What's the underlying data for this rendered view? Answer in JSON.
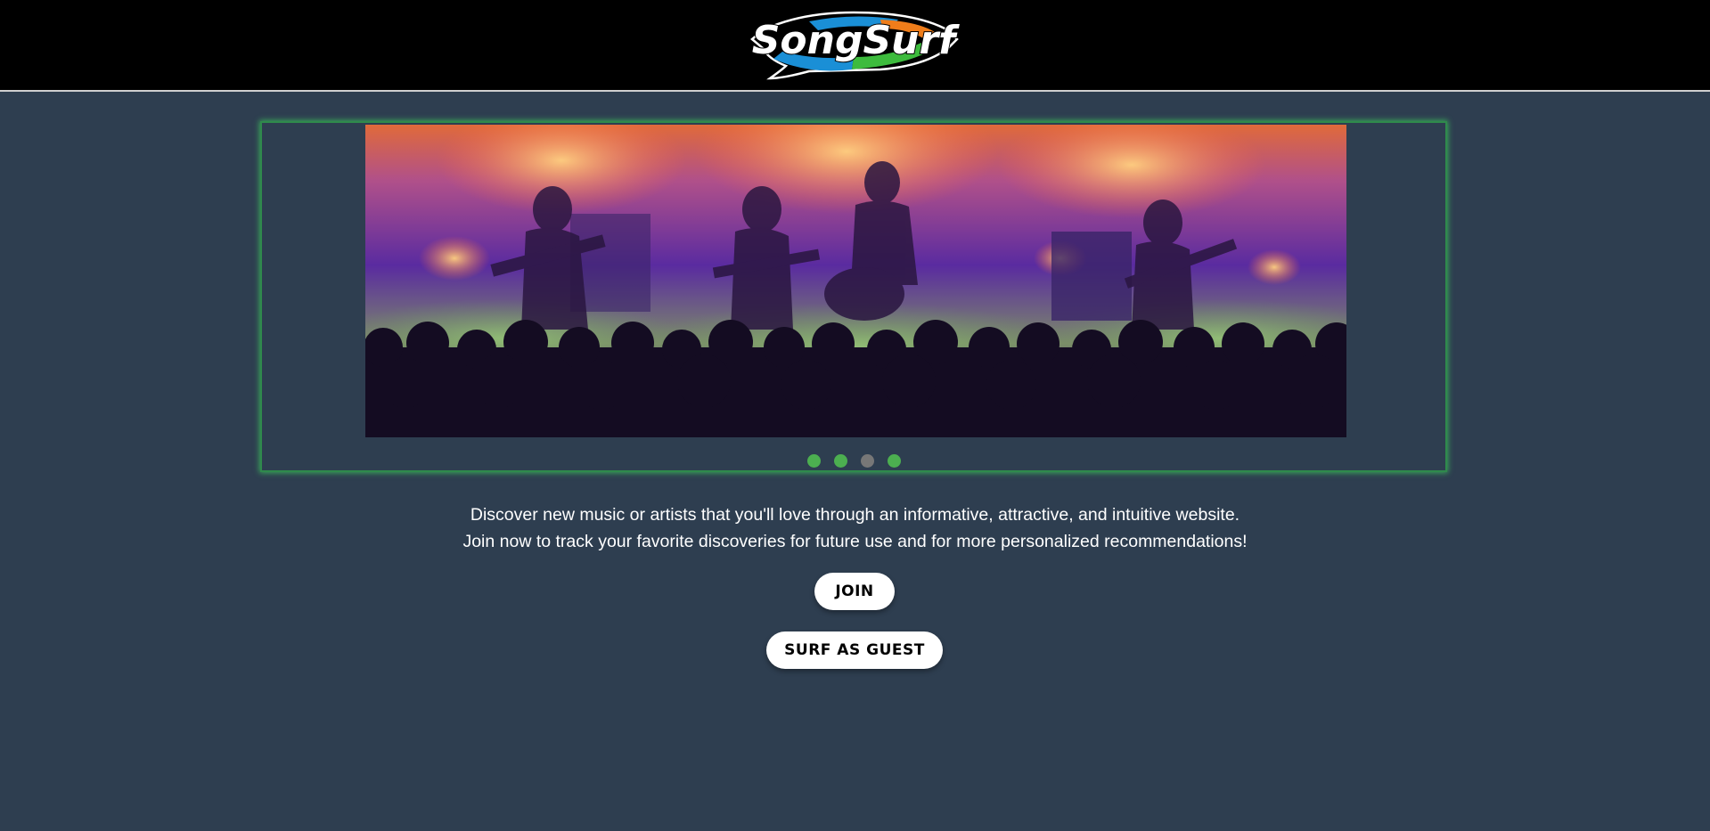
{
  "header": {
    "logo": {
      "text": "SongSurf",
      "colors": {
        "blue": "#1a8fd6",
        "green": "#3dbb3d",
        "orange": "#ef7d1a",
        "white": "#ffffff"
      }
    }
  },
  "carousel": {
    "slide_image": "concert-band-on-stage-image",
    "border_color": "#2f8a4c",
    "dots": [
      {
        "state": "inactive",
        "color": "#4caf50"
      },
      {
        "state": "inactive",
        "color": "#4caf50"
      },
      {
        "state": "active",
        "color": "#777777"
      },
      {
        "state": "inactive",
        "color": "#4caf50"
      }
    ]
  },
  "intro": {
    "line1": "Discover new music or artists that you'll love through an informative, attractive, and intuitive website.",
    "line2": "Join now to track your favorite discoveries for future use and for more personalized recommendations!"
  },
  "actions": {
    "join_label": "JOIN",
    "guest_label": "SURF AS GUEST"
  }
}
